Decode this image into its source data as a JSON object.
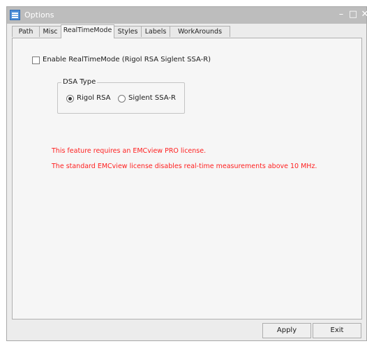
{
  "window": {
    "title": "Options",
    "controls": {
      "minimize": "–",
      "maximize": "□",
      "close": "✕"
    }
  },
  "tabs": [
    {
      "label": "Path"
    },
    {
      "label": "Misc"
    },
    {
      "label": "RealTimeMode",
      "active": true
    },
    {
      "label": "Styles"
    },
    {
      "label": "Labels"
    },
    {
      "label": "WorkArounds"
    }
  ],
  "realtime": {
    "enable_label": "Enable RealTimeMode (Rigol RSA  Siglent SSA-R)",
    "enable_checked": false,
    "dsa_group_title": "DSA Type",
    "dsa_options": [
      {
        "label": "Rigol RSA",
        "selected": true
      },
      {
        "label": "Siglent SSA-R",
        "selected": false
      }
    ]
  },
  "notice": {
    "line1": "This feature requires an EMCview PRO license.",
    "line2": "The standard EMCview license disables real-time measurements above 10 MHz.",
    "color": "#ff2020"
  },
  "buttons": {
    "apply": "Apply",
    "exit": "Exit"
  }
}
